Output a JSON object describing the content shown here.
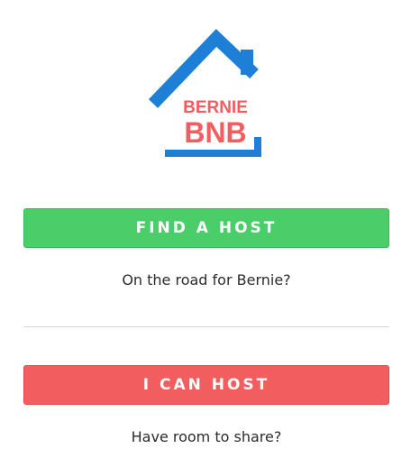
{
  "logo": {
    "line1": "BERNIE",
    "line2": "BNB",
    "house_color": "#1e7fd6",
    "text_color": "#f25d5f"
  },
  "find_host": {
    "label": "FIND A HOST",
    "caption": "On the road for Bernie?",
    "color": "#4bcd69"
  },
  "can_host": {
    "label": "I CAN HOST",
    "caption": "Have room to share?",
    "color": "#f25d5f"
  }
}
